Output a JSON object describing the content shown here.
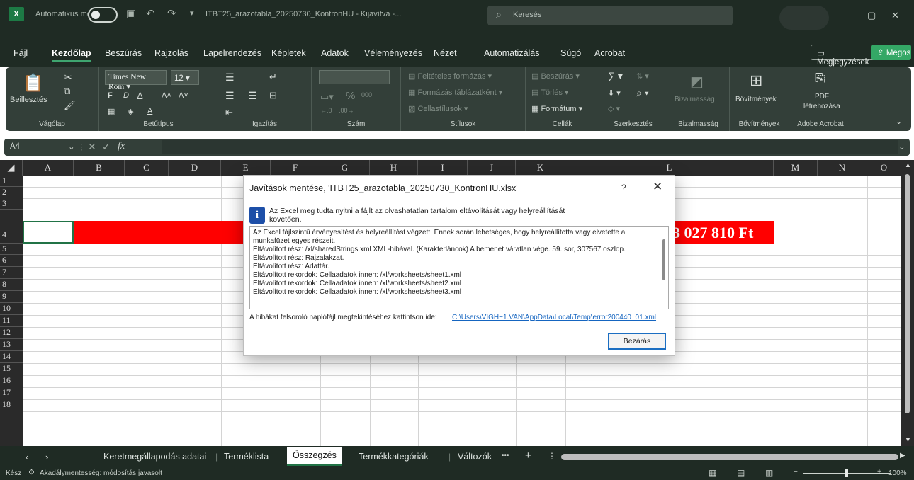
{
  "titlebar": {
    "autosave_label": "Automatikus mentés",
    "filename": "ITBT25_arazotabla_20250730_KontronHU  -  Kijavítva  -...",
    "search_placeholder": "Keresés",
    "minimize": "—",
    "maximize": "▢",
    "close": "✕"
  },
  "menu": {
    "items": [
      "Fájl",
      "Kezdőlap",
      "Beszúrás",
      "Rajzolás",
      "Lapelrendezés",
      "Képletek",
      "Adatok",
      "Véleményezés",
      "Nézet",
      "Automatizálás",
      "Súgó",
      "Acrobat"
    ],
    "comments_button": "Megjegyzések",
    "share_button": "Megosztás"
  },
  "ribbon": {
    "clipboard": {
      "paste_label": "Beillesztés",
      "group": "Vágólap"
    },
    "font": {
      "name": "Times New Rom",
      "size": "12",
      "group": "Betűtípus"
    },
    "alignment": {
      "group": "Igazítás"
    },
    "number": {
      "group": "Szám"
    },
    "styles": {
      "conditional": "Feltételes formázás",
      "table": "Formázás táblázatként",
      "cell_styles": "Cellastílusok",
      "group": "Stílusok"
    },
    "cells": {
      "insert": "Beszúrás",
      "delete": "Törlés",
      "format": "Formátum",
      "group": "Cellák"
    },
    "editing": {
      "group": "Szerkesztés"
    },
    "sensitivity": {
      "label": "Bizalmasság",
      "group": "Bizalmasság"
    },
    "addins": {
      "label": "Bővítmények",
      "group": "Bővítmények"
    },
    "acrobat": {
      "pdf": "PDF",
      "create": "létrehozása",
      "group": "Adobe Acrobat"
    }
  },
  "formula": {
    "namebox": "A4",
    "fx": "fx"
  },
  "columns": [
    "A",
    "B",
    "C",
    "D",
    "E",
    "F",
    "G",
    "H",
    "I",
    "J",
    "K",
    "L",
    "M",
    "N",
    "O"
  ],
  "rows": [
    "1",
    "2",
    "3",
    "4",
    "5",
    "6",
    "7",
    "8",
    "9",
    "10",
    "11",
    "12",
    "13",
    "14",
    "15",
    "16",
    "17",
    "18"
  ],
  "cell_amount": "3 027 810 Ft",
  "dialog": {
    "title": "Javítások mentése, 'ITBT25_arazotabla_20250730_KontronHU.xlsx'",
    "help": "?",
    "close_x": "✕",
    "icon": "i",
    "summary": "Az Excel meg tudta nyitni a fájlt az olvashatatlan tartalom eltávolítását vagy helyreállítását követően.",
    "details": [
      "Az Excel fájlszintű érvényesítést és helyreállítást végzett. Ennek során lehetséges, hogy helyreállította vagy elvetette a munkafüzet egyes részeit.",
      "Eltávolított rész: /xl/sharedStrings.xml XML-hibával.  (Karakterláncok) A bemenet váratlan vége. 59. sor, 307567 oszlop.",
      "Eltávolított rész: Rajzalakzat.",
      "Eltávolított rész: Adattár.",
      "Eltávolított rekordok: Cellaadatok innen: /xl/worksheets/sheet1.xml",
      "Eltávolított rekordok: Cellaadatok innen: /xl/worksheets/sheet2.xml",
      "Eltávolított rekordok: Cellaadatok innen: /xl/worksheets/sheet3.xml"
    ],
    "log_label": "A hibákat felsoroló naplófájl megtekintéséhez kattintson ide:",
    "log_link": "C:\\Users\\VIGH~1.VAN\\AppData\\Local\\Temp\\error200440_01.xml",
    "close_button": "Bezárás"
  },
  "sheets": {
    "tabs": [
      "Keretmegállapodás adatai",
      "Terméklista",
      "Összegzés",
      "Termékkategóriák",
      "Változók"
    ],
    "active": "Összegzés",
    "more": "•••",
    "add": "+"
  },
  "status": {
    "ready": "Kész",
    "accessibility": "Akadálymentesség: módosítás javasolt",
    "zoom": "100%"
  }
}
